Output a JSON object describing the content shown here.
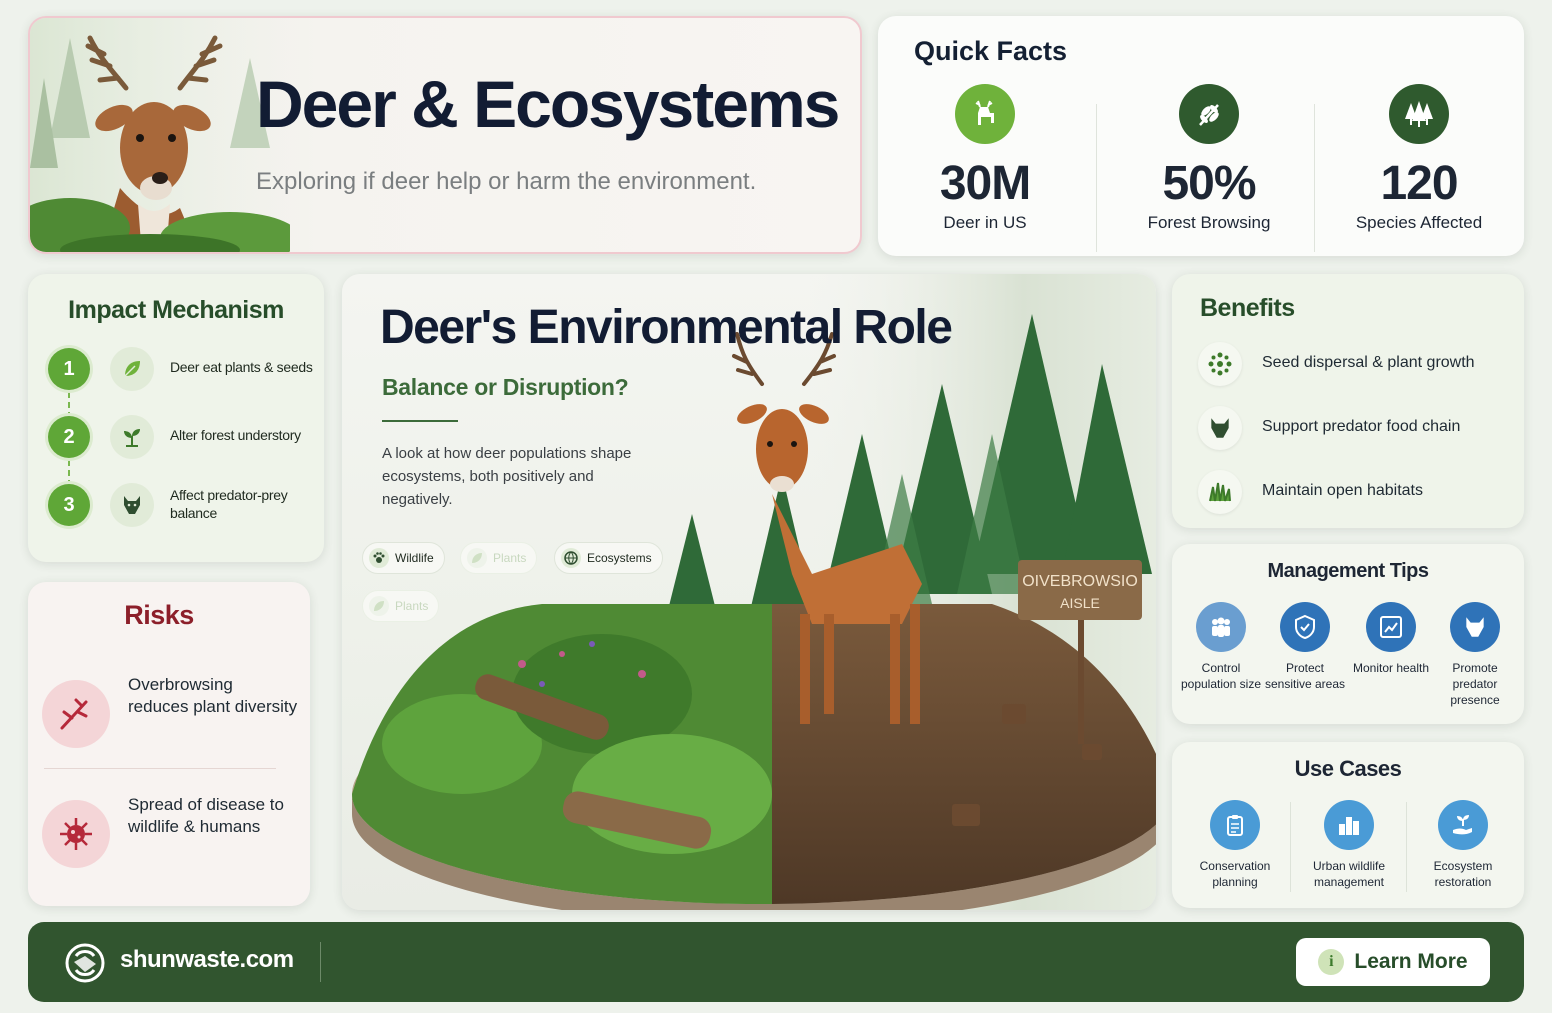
{
  "hero": {
    "title": "Deer & Ecosystems",
    "subtitle": "Exploring if deer help or harm the environment."
  },
  "quick_facts": {
    "heading": "Quick Facts",
    "items": [
      {
        "value": "30M",
        "label": "Deer in US",
        "icon": "deer-icon",
        "color": "#6fb23b"
      },
      {
        "value": "50%",
        "label": "Forest Browsing",
        "icon": "leaf-branch-icon",
        "color": "#2f5a2e"
      },
      {
        "value": "120",
        "label": "Species Affected",
        "icon": "trees-icon",
        "color": "#2f5a2e"
      }
    ]
  },
  "impact": {
    "heading": "Impact Mechanism",
    "steps": [
      {
        "num": "1",
        "label": "Deer eat plants & seeds",
        "icon": "leaf-icon"
      },
      {
        "num": "2",
        "label": "Alter forest understory",
        "icon": "sprout-icon"
      },
      {
        "num": "3",
        "label": "Affect predator-prey balance",
        "icon": "wolf-icon"
      }
    ]
  },
  "risks": {
    "heading": "Risks",
    "items": [
      {
        "label": "Overbrowsing reduces plant diversity",
        "icon": "broken-branch-icon"
      },
      {
        "label": "Spread of disease to wildlife & humans",
        "icon": "virus-icon"
      }
    ]
  },
  "center": {
    "title": "Deer's Environmental Role",
    "subtitle": "Balance or Disruption?",
    "description": "A look at how deer populations shape ecosystems, both positively and negatively.",
    "chips": [
      {
        "label": "Wildlife",
        "icon": "paw-icon"
      },
      {
        "label": "Plants",
        "icon": "leaf-icon"
      },
      {
        "label": "Ecosystems",
        "icon": "globe-icon"
      },
      {
        "label": "Plants",
        "icon": "leaf-icon"
      }
    ],
    "sign_text_1": "OIVEBROWSIO",
    "sign_text_2": "AISLE"
  },
  "benefits": {
    "heading": "Benefits",
    "items": [
      {
        "label": "Seed dispersal & plant growth",
        "icon": "seeds-icon"
      },
      {
        "label": "Support predator food chain",
        "icon": "wolf-icon"
      },
      {
        "label": "Maintain open habitats",
        "icon": "grass-icon"
      }
    ]
  },
  "management": {
    "heading": "Management Tips",
    "items": [
      {
        "label": "Control population size",
        "icon": "people-icon",
        "color": "#6a9ed0"
      },
      {
        "label": "Protect sensitive areas",
        "icon": "shield-icon",
        "color": "#2f73b8"
      },
      {
        "label": "Monitor health",
        "icon": "chart-icon",
        "color": "#2f73b8"
      },
      {
        "label": "Promote predator presence",
        "icon": "wolf-icon",
        "color": "#2f73b8"
      }
    ]
  },
  "use_cases": {
    "heading": "Use Cases",
    "items": [
      {
        "label": "Conservation planning",
        "icon": "clipboard-icon"
      },
      {
        "label": "Urban wildlife management",
        "icon": "city-icon"
      },
      {
        "label": "Ecosystem restoration",
        "icon": "hand-sprout-icon"
      }
    ]
  },
  "footer": {
    "brand": "shunwaste.com",
    "button_label": "Learn More",
    "button_icon": "info-icon"
  }
}
